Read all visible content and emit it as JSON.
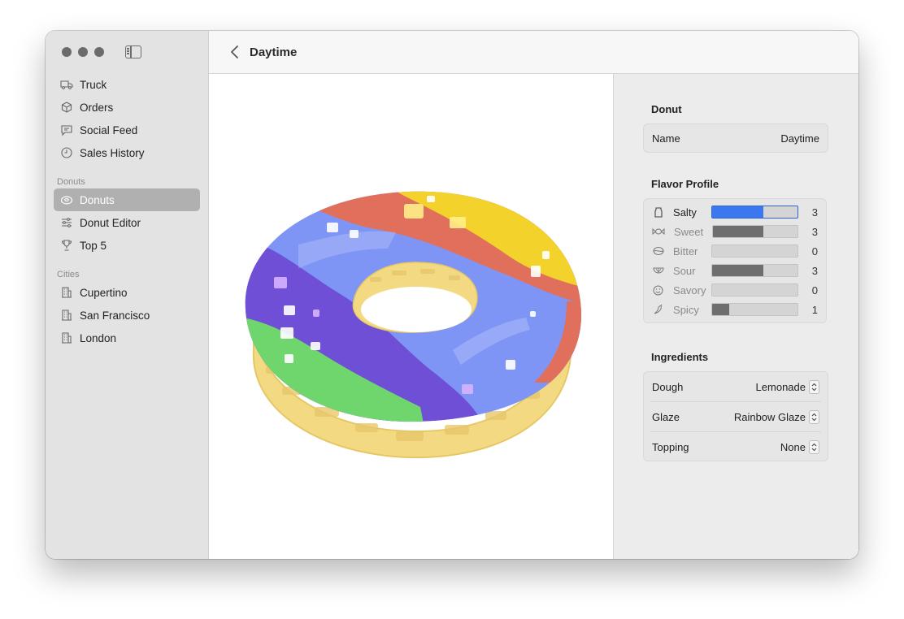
{
  "window": {
    "title": "Daytime"
  },
  "sidebar": {
    "items": [
      {
        "label": "Truck",
        "icon": "truck-icon"
      },
      {
        "label": "Orders",
        "icon": "box-icon"
      },
      {
        "label": "Social Feed",
        "icon": "chat-bubble-icon"
      },
      {
        "label": "Sales History",
        "icon": "clock-icon"
      }
    ],
    "donuts_section": {
      "label": "Donuts",
      "items": [
        {
          "label": "Donuts",
          "icon": "donut-icon",
          "selected": true
        },
        {
          "label": "Donut Editor",
          "icon": "sliders-icon"
        },
        {
          "label": "Top 5",
          "icon": "trophy-icon"
        }
      ]
    },
    "cities_section": {
      "label": "Cities",
      "items": [
        {
          "label": "Cupertino",
          "icon": "building-icon"
        },
        {
          "label": "San Francisco",
          "icon": "building-icon"
        },
        {
          "label": "London",
          "icon": "building-icon"
        }
      ]
    }
  },
  "inspector": {
    "donut": {
      "heading": "Donut",
      "name_label": "Name",
      "name_value": "Daytime"
    },
    "flavor_profile": {
      "heading": "Flavor Profile",
      "max": 5,
      "items": [
        {
          "label": "Salty",
          "value": 3,
          "icon": "salt-shaker-icon",
          "active": true
        },
        {
          "label": "Sweet",
          "value": 3,
          "icon": "candy-icon"
        },
        {
          "label": "Bitter",
          "value": 0,
          "icon": "coffee-bean-icon"
        },
        {
          "label": "Sour",
          "value": 3,
          "icon": "citrus-icon"
        },
        {
          "label": "Savory",
          "value": 0,
          "icon": "smiley-icon"
        },
        {
          "label": "Spicy",
          "value": 1,
          "icon": "chili-pepper-icon"
        }
      ]
    },
    "ingredients": {
      "heading": "Ingredients",
      "rows": [
        {
          "label": "Dough",
          "value": "Lemonade"
        },
        {
          "label": "Glaze",
          "value": "Rainbow Glaze"
        },
        {
          "label": "Topping",
          "value": "None"
        }
      ]
    }
  },
  "colors": {
    "accent": "#3b78f0",
    "sidebar_bg": "#e3e3e3",
    "selection": "#b0b0b0",
    "dough": "#f2d77c",
    "glaze_yellow": "#f4d22c",
    "glaze_red": "#e0705c",
    "glaze_blue": "#7f95f5",
    "glaze_purple": "#6e4fd6",
    "glaze_green": "#6fd66e"
  }
}
